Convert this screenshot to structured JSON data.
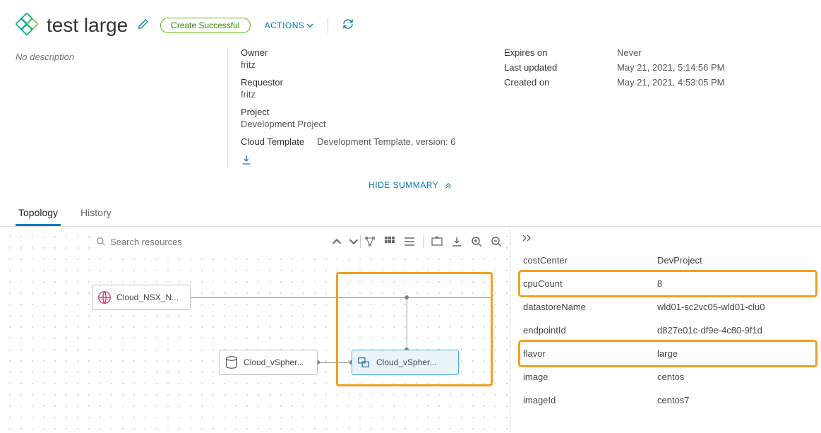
{
  "header": {
    "title": "test large",
    "status": "Create Successful",
    "actions_label": "ACTIONS"
  },
  "description_placeholder": "No description",
  "summary": {
    "owner_label": "Owner",
    "owner_value": "fritz",
    "requestor_label": "Requestor",
    "requestor_value": "fritz",
    "project_label": "Project",
    "project_value": "Development Project",
    "cloud_template_label": "Cloud Template",
    "cloud_template_value": "Development Template, version: 6",
    "expires_label": "Expires on",
    "expires_value": "Never",
    "updated_label": "Last updated",
    "updated_value": "May 21, 2021, 5:14:56 PM",
    "created_label": "Created on",
    "created_value": "May 21, 2021, 4:53:05 PM"
  },
  "hide_summary": "HIDE SUMMARY",
  "tabs": {
    "topology": "Topology",
    "history": "History"
  },
  "search_placeholder": "Search resources",
  "nodes": {
    "net": "Cloud_NSX_N...",
    "dsk": "Cloud_vSpher...",
    "vm": "Cloud_vSpher..."
  },
  "properties": [
    {
      "key": "costCenter",
      "value": "DevProject",
      "hl": false
    },
    {
      "key": "cpuCount",
      "value": "8",
      "hl": true
    },
    {
      "key": "datastoreName",
      "value": "wld01-sc2vc05-wld01-clu0",
      "hl": false
    },
    {
      "key": "endpointId",
      "value": "d827e01c-df9e-4c80-9f1d",
      "hl": false
    },
    {
      "key": "flavor",
      "value": "large",
      "hl": true
    },
    {
      "key": "image",
      "value": "centos",
      "hl": false
    },
    {
      "key": "imageId",
      "value": "centos7",
      "hl": false
    }
  ]
}
